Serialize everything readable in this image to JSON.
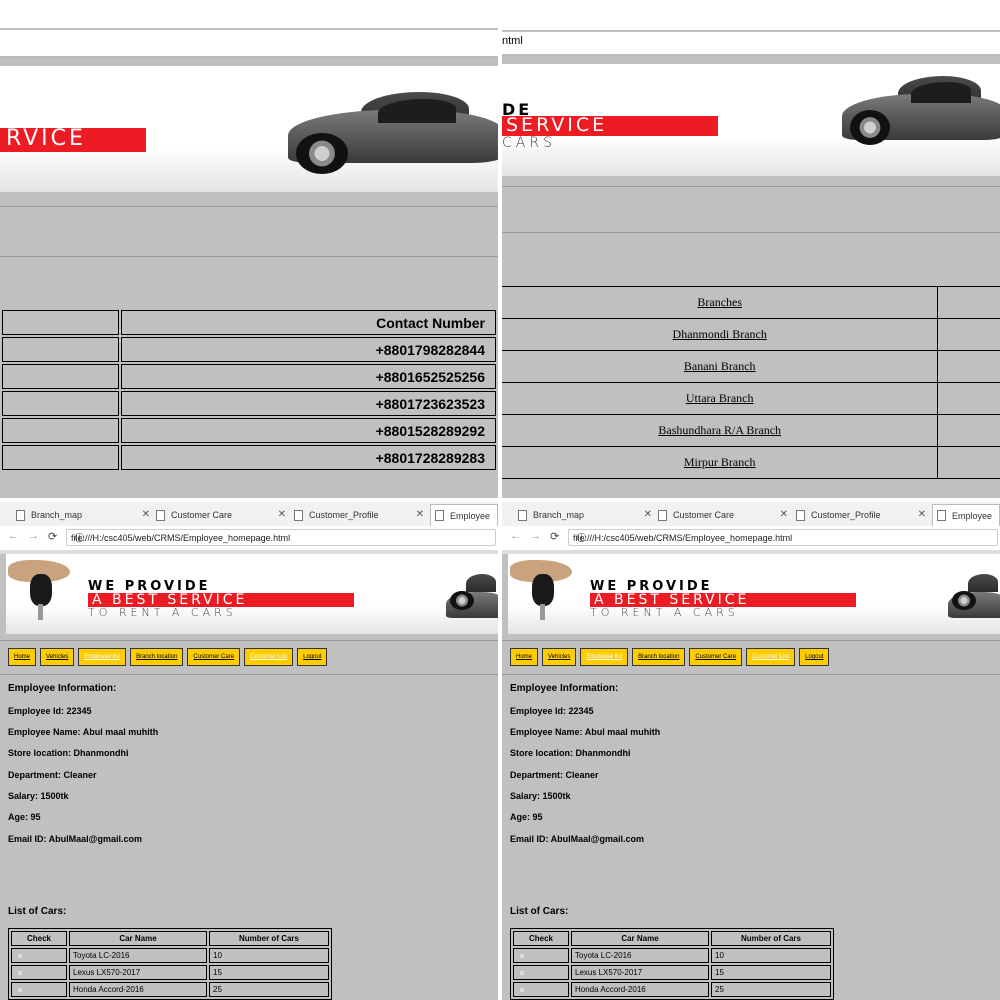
{
  "window": {
    "url_fragment": "ntml",
    "tabs": [
      {
        "label": "Branch_map",
        "active": false
      },
      {
        "label": "Customer Care",
        "active": false
      },
      {
        "label": "Customer_Profile",
        "active": false
      },
      {
        "label": "Employee",
        "active": true
      }
    ],
    "url": "file:///H:/csc405/web/CRMS/Employee_homepage.html"
  },
  "banner": {
    "line1": "WE PROVIDE",
    "line2": "A BEST SERVICE",
    "line3": "TO RENT A CARS",
    "crop_q1": "RVICE",
    "crop_q2_top": "DE",
    "crop_q2_mid": "SERVICE",
    "crop_q2_bot": "CARS"
  },
  "contacts": {
    "header": "Contact Number",
    "numbers": [
      "+8801798282844",
      "+8801652525256",
      "+8801723623523",
      "+8801528289292",
      "+8801728289283"
    ]
  },
  "branches": {
    "header": "Branches",
    "items": [
      "Dhanmondi Branch",
      "Banani Branch",
      "Uttara Branch",
      "Bashundhara R/A Branch",
      "Mirpur Branch"
    ]
  },
  "menu": {
    "items": [
      "Home",
      "Vehicles",
      "Employee list",
      "Branch location",
      "Customer Care",
      "Customer List",
      "Logout"
    ]
  },
  "employee": {
    "heading": "Employee Information:",
    "id": "Employee Id: 22345",
    "name": "Employee Name: Abul maal muhith",
    "store": "Store location: Dhanmondhi",
    "department": "Department: Cleaner",
    "salary": "Salary: 1500tk",
    "age": "Age: 95",
    "email": "Email ID: AbulMaal@gmail.com"
  },
  "cars": {
    "heading": "List of Cars:",
    "columns": [
      "Check",
      "Car Name",
      "Number of Cars"
    ],
    "rows": [
      {
        "name": "Toyota LC-2016",
        "count": "10"
      },
      {
        "name": "Lexus LX570-2017",
        "count": "15"
      },
      {
        "name": "Honda Accord-2016",
        "count": "25"
      }
    ]
  },
  "colors": {
    "page_bg": "#c0c0c0",
    "menu_button": "#ffcc00",
    "banner_red": "#ed1c24"
  }
}
